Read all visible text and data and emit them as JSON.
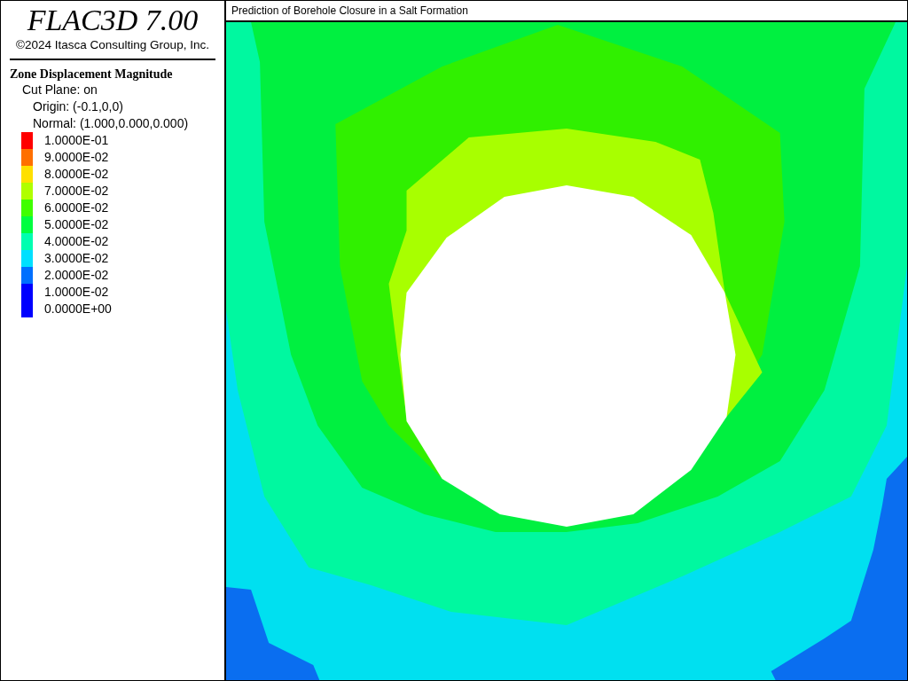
{
  "header": {
    "product": "FLAC3D 7.00",
    "copyright": "©2024 Itasca Consulting Group, Inc."
  },
  "legend": {
    "title": "Zone Displacement Magnitude",
    "lines": [
      "Cut Plane: on",
      "Origin: (-0.1,0,0)",
      "Normal: (1.000,0.000,0.000)"
    ],
    "levels": [
      {
        "label": "1.0000E-01",
        "color": "#ff0000"
      },
      {
        "label": "9.0000E-02",
        "color": "#ff7000"
      },
      {
        "label": "8.0000E-02",
        "color": "#ffe000"
      },
      {
        "label": "7.0000E-02",
        "color": "#b0ff00"
      },
      {
        "label": "6.0000E-02",
        "color": "#40ff00"
      },
      {
        "label": "5.0000E-02",
        "color": "#00ff40"
      },
      {
        "label": "4.0000E-02",
        "color": "#00ffb0"
      },
      {
        "label": "3.0000E-02",
        "color": "#00e0ff"
      },
      {
        "label": "2.0000E-02",
        "color": "#0070ff"
      },
      {
        "label": "1.0000E-02",
        "color": "#0000ff"
      },
      {
        "label": "0.0000E+00",
        "color": "#0000ff"
      }
    ]
  },
  "plot": {
    "title": "Prediction of Borehole Closure in a Salt Formation"
  }
}
